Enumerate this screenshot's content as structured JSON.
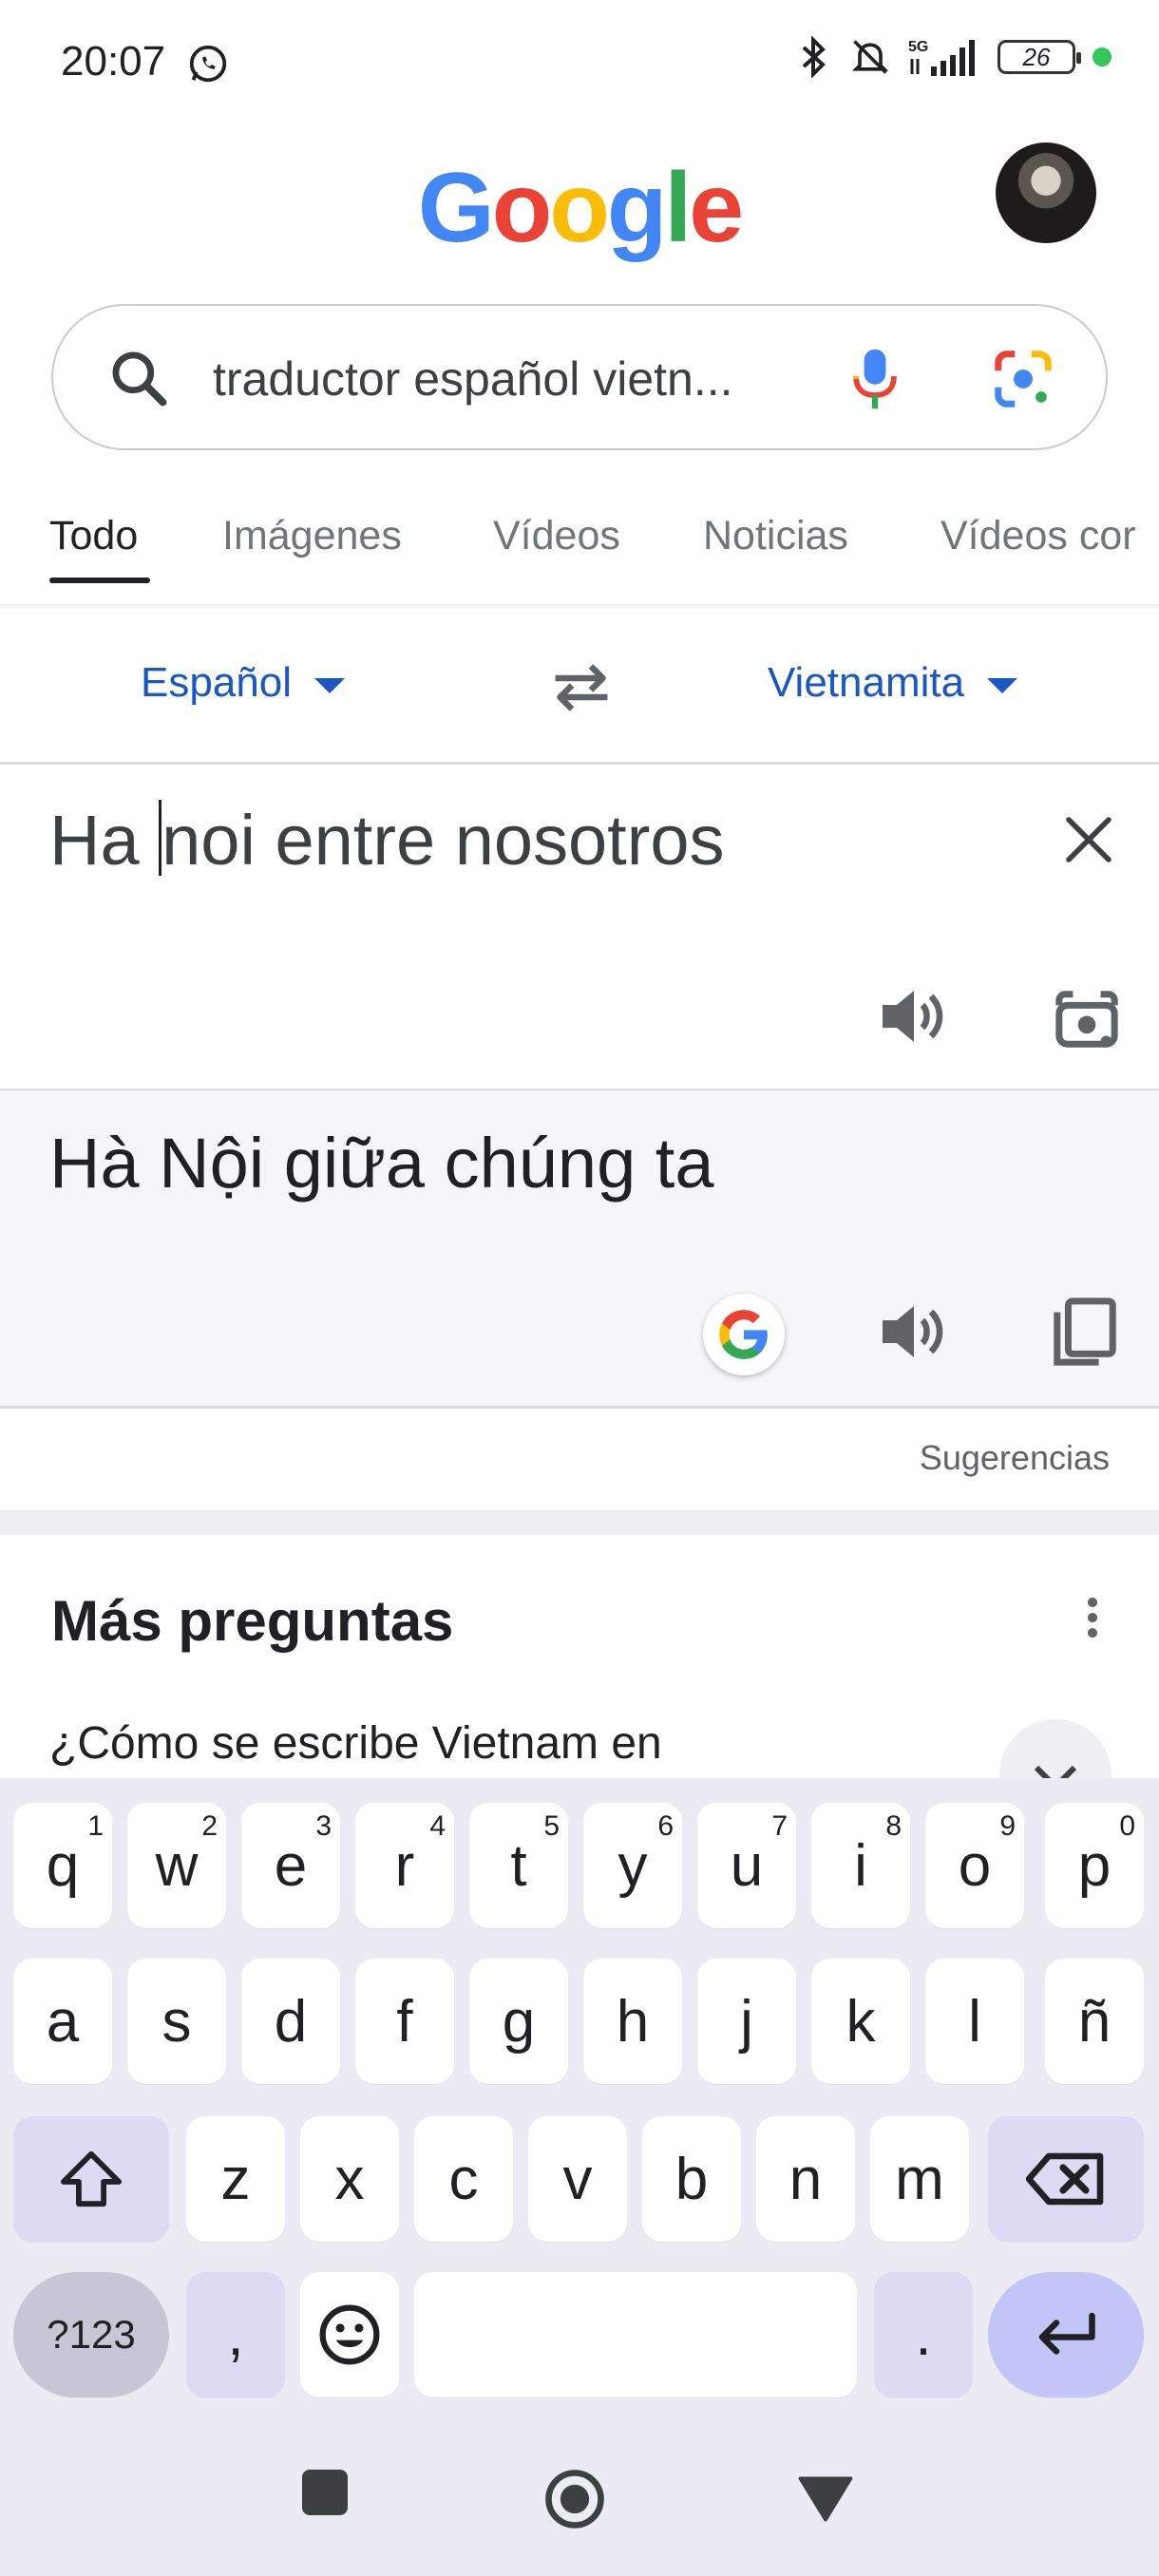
{
  "status_bar": {
    "time": "20:07",
    "battery": "26"
  },
  "logo": {
    "letters": [
      "G",
      "o",
      "o",
      "g",
      "l",
      "e"
    ],
    "colors": [
      "#4285f4",
      "#ea4335",
      "#fbbc05",
      "#4285f4",
      "#34a853",
      "#ea4335"
    ]
  },
  "search": {
    "query": "traductor español vietn..."
  },
  "tabs": [
    "Todo",
    "Imágenes",
    "Vídeos",
    "Noticias",
    "Vídeos cor"
  ],
  "translator": {
    "source_lang": "Español",
    "target_lang": "Vietnamita",
    "source_before_cursor": "Ha ",
    "source_after_cursor": "noi entre nosotros",
    "translation": "Hà Nội giữa chúng ta",
    "feedback_link": "Sugerencias"
  },
  "more_questions": {
    "title": "Más preguntas",
    "question": "¿Cómo se escribe Vietnam en"
  },
  "keyboard": {
    "row1": [
      {
        "k": "q",
        "s": "1"
      },
      {
        "k": "w",
        "s": "2"
      },
      {
        "k": "e",
        "s": "3"
      },
      {
        "k": "r",
        "s": "4"
      },
      {
        "k": "t",
        "s": "5"
      },
      {
        "k": "y",
        "s": "6"
      },
      {
        "k": "u",
        "s": "7"
      },
      {
        "k": "i",
        "s": "8"
      },
      {
        "k": "o",
        "s": "9"
      },
      {
        "k": "p",
        "s": "0"
      }
    ],
    "row2": [
      "a",
      "s",
      "d",
      "f",
      "g",
      "h",
      "j",
      "k",
      "l",
      "ñ"
    ],
    "row3": [
      "z",
      "x",
      "c",
      "v",
      "b",
      "n",
      "m"
    ],
    "symbols_label": "?123",
    "comma": ",",
    "period": "."
  }
}
